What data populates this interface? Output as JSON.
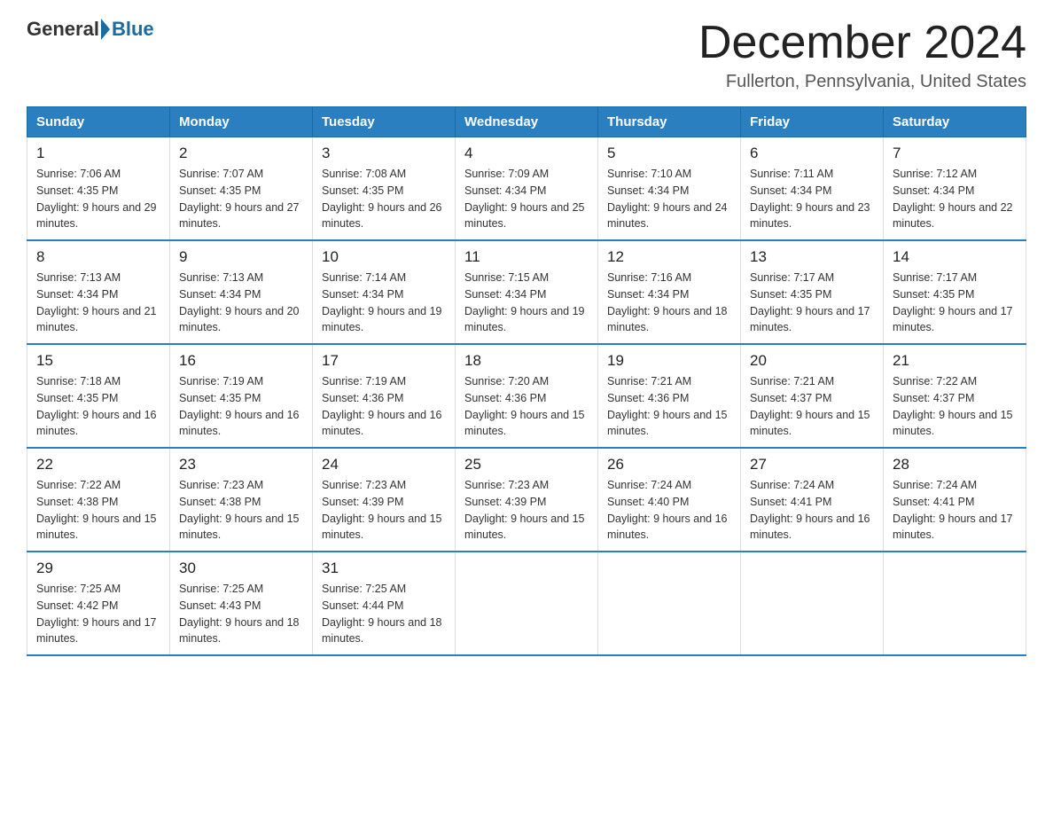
{
  "header": {
    "logo_general": "General",
    "logo_blue": "Blue",
    "month_title": "December 2024",
    "location": "Fullerton, Pennsylvania, United States"
  },
  "days_of_week": [
    "Sunday",
    "Monday",
    "Tuesday",
    "Wednesday",
    "Thursday",
    "Friday",
    "Saturday"
  ],
  "weeks": [
    [
      {
        "day": "1",
        "sunrise": "7:06 AM",
        "sunset": "4:35 PM",
        "daylight": "9 hours and 29 minutes."
      },
      {
        "day": "2",
        "sunrise": "7:07 AM",
        "sunset": "4:35 PM",
        "daylight": "9 hours and 27 minutes."
      },
      {
        "day": "3",
        "sunrise": "7:08 AM",
        "sunset": "4:35 PM",
        "daylight": "9 hours and 26 minutes."
      },
      {
        "day": "4",
        "sunrise": "7:09 AM",
        "sunset": "4:34 PM",
        "daylight": "9 hours and 25 minutes."
      },
      {
        "day": "5",
        "sunrise": "7:10 AM",
        "sunset": "4:34 PM",
        "daylight": "9 hours and 24 minutes."
      },
      {
        "day": "6",
        "sunrise": "7:11 AM",
        "sunset": "4:34 PM",
        "daylight": "9 hours and 23 minutes."
      },
      {
        "day": "7",
        "sunrise": "7:12 AM",
        "sunset": "4:34 PM",
        "daylight": "9 hours and 22 minutes."
      }
    ],
    [
      {
        "day": "8",
        "sunrise": "7:13 AM",
        "sunset": "4:34 PM",
        "daylight": "9 hours and 21 minutes."
      },
      {
        "day": "9",
        "sunrise": "7:13 AM",
        "sunset": "4:34 PM",
        "daylight": "9 hours and 20 minutes."
      },
      {
        "day": "10",
        "sunrise": "7:14 AM",
        "sunset": "4:34 PM",
        "daylight": "9 hours and 19 minutes."
      },
      {
        "day": "11",
        "sunrise": "7:15 AM",
        "sunset": "4:34 PM",
        "daylight": "9 hours and 19 minutes."
      },
      {
        "day": "12",
        "sunrise": "7:16 AM",
        "sunset": "4:34 PM",
        "daylight": "9 hours and 18 minutes."
      },
      {
        "day": "13",
        "sunrise": "7:17 AM",
        "sunset": "4:35 PM",
        "daylight": "9 hours and 17 minutes."
      },
      {
        "day": "14",
        "sunrise": "7:17 AM",
        "sunset": "4:35 PM",
        "daylight": "9 hours and 17 minutes."
      }
    ],
    [
      {
        "day": "15",
        "sunrise": "7:18 AM",
        "sunset": "4:35 PM",
        "daylight": "9 hours and 16 minutes."
      },
      {
        "day": "16",
        "sunrise": "7:19 AM",
        "sunset": "4:35 PM",
        "daylight": "9 hours and 16 minutes."
      },
      {
        "day": "17",
        "sunrise": "7:19 AM",
        "sunset": "4:36 PM",
        "daylight": "9 hours and 16 minutes."
      },
      {
        "day": "18",
        "sunrise": "7:20 AM",
        "sunset": "4:36 PM",
        "daylight": "9 hours and 15 minutes."
      },
      {
        "day": "19",
        "sunrise": "7:21 AM",
        "sunset": "4:36 PM",
        "daylight": "9 hours and 15 minutes."
      },
      {
        "day": "20",
        "sunrise": "7:21 AM",
        "sunset": "4:37 PM",
        "daylight": "9 hours and 15 minutes."
      },
      {
        "day": "21",
        "sunrise": "7:22 AM",
        "sunset": "4:37 PM",
        "daylight": "9 hours and 15 minutes."
      }
    ],
    [
      {
        "day": "22",
        "sunrise": "7:22 AM",
        "sunset": "4:38 PM",
        "daylight": "9 hours and 15 minutes."
      },
      {
        "day": "23",
        "sunrise": "7:23 AM",
        "sunset": "4:38 PM",
        "daylight": "9 hours and 15 minutes."
      },
      {
        "day": "24",
        "sunrise": "7:23 AM",
        "sunset": "4:39 PM",
        "daylight": "9 hours and 15 minutes."
      },
      {
        "day": "25",
        "sunrise": "7:23 AM",
        "sunset": "4:39 PM",
        "daylight": "9 hours and 15 minutes."
      },
      {
        "day": "26",
        "sunrise": "7:24 AM",
        "sunset": "4:40 PM",
        "daylight": "9 hours and 16 minutes."
      },
      {
        "day": "27",
        "sunrise": "7:24 AM",
        "sunset": "4:41 PM",
        "daylight": "9 hours and 16 minutes."
      },
      {
        "day": "28",
        "sunrise": "7:24 AM",
        "sunset": "4:41 PM",
        "daylight": "9 hours and 17 minutes."
      }
    ],
    [
      {
        "day": "29",
        "sunrise": "7:25 AM",
        "sunset": "4:42 PM",
        "daylight": "9 hours and 17 minutes."
      },
      {
        "day": "30",
        "sunrise": "7:25 AM",
        "sunset": "4:43 PM",
        "daylight": "9 hours and 18 minutes."
      },
      {
        "day": "31",
        "sunrise": "7:25 AM",
        "sunset": "4:44 PM",
        "daylight": "9 hours and 18 minutes."
      },
      null,
      null,
      null,
      null
    ]
  ]
}
